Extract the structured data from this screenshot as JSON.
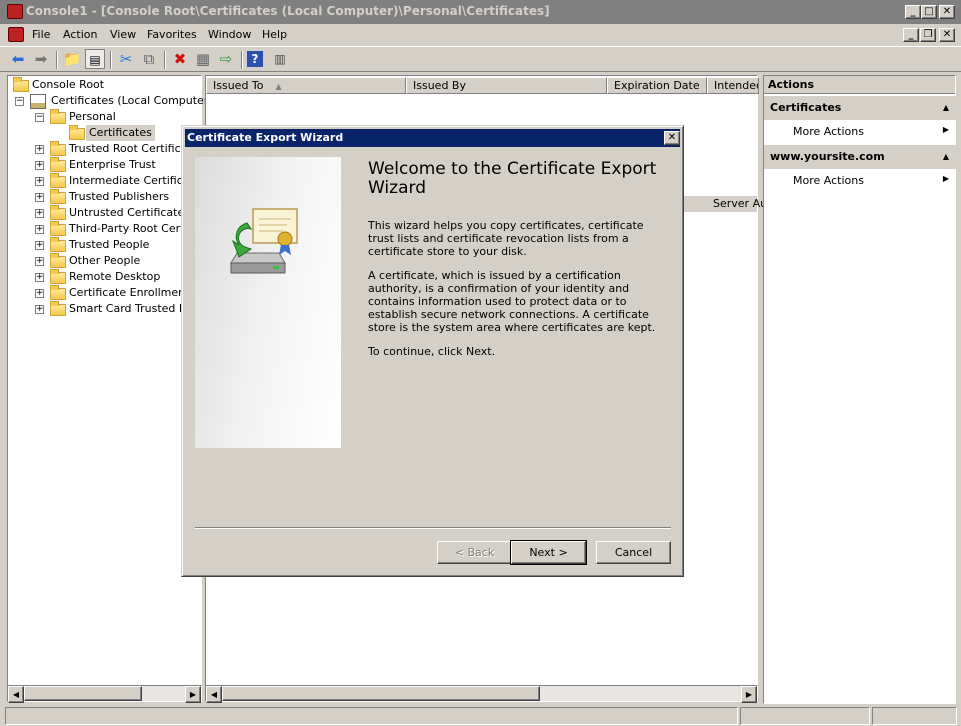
{
  "window": {
    "title": "Console1 - [Console Root\\Certificates (Local Computer)\\Personal\\Certificates]",
    "controls": {
      "minimize": "_",
      "maximize": "□",
      "close": "✕"
    }
  },
  "menu": [
    "File",
    "Action",
    "View",
    "Favorites",
    "Window",
    "Help"
  ],
  "tree": {
    "root": "Console Root",
    "computer": "Certificates (Local Computer)",
    "personal": "Personal",
    "selected": "Certificates",
    "stores": [
      "Trusted Root Certificati",
      "Enterprise Trust",
      "Intermediate Certificati",
      "Trusted Publishers",
      "Untrusted Certificates",
      "Third-Party Root Certifi",
      "Trusted People",
      "Other People",
      "Remote Desktop",
      "Certificate Enrollment R",
      "Smart Card Trusted Roo"
    ]
  },
  "list": {
    "columns": [
      "Issued To",
      "Issued By",
      "Expiration Date",
      "Intended"
    ],
    "sort_indicator": "▲",
    "row_fragment": "Server Au"
  },
  "actions": {
    "header": "Actions",
    "sections": [
      {
        "title": "Certificates",
        "item": "More Actions"
      },
      {
        "title": "www.yoursite.com",
        "item": "More Actions"
      }
    ]
  },
  "dialog": {
    "title": "Certificate Export Wizard",
    "heading": "Welcome to the Certificate Export Wizard",
    "para1": "This wizard helps you copy certificates, certificate trust lists and certificate revocation lists from a certificate store to your disk.",
    "para2": "A certificate, which is issued by a certification authority, is a confirmation of your identity and contains information used to protect data or to establish secure network connections. A certificate store is the system area where certificates are kept.",
    "para3": "To continue, click Next.",
    "back_label": "< Back",
    "next_label": "Next >",
    "cancel_label": "Cancel"
  }
}
